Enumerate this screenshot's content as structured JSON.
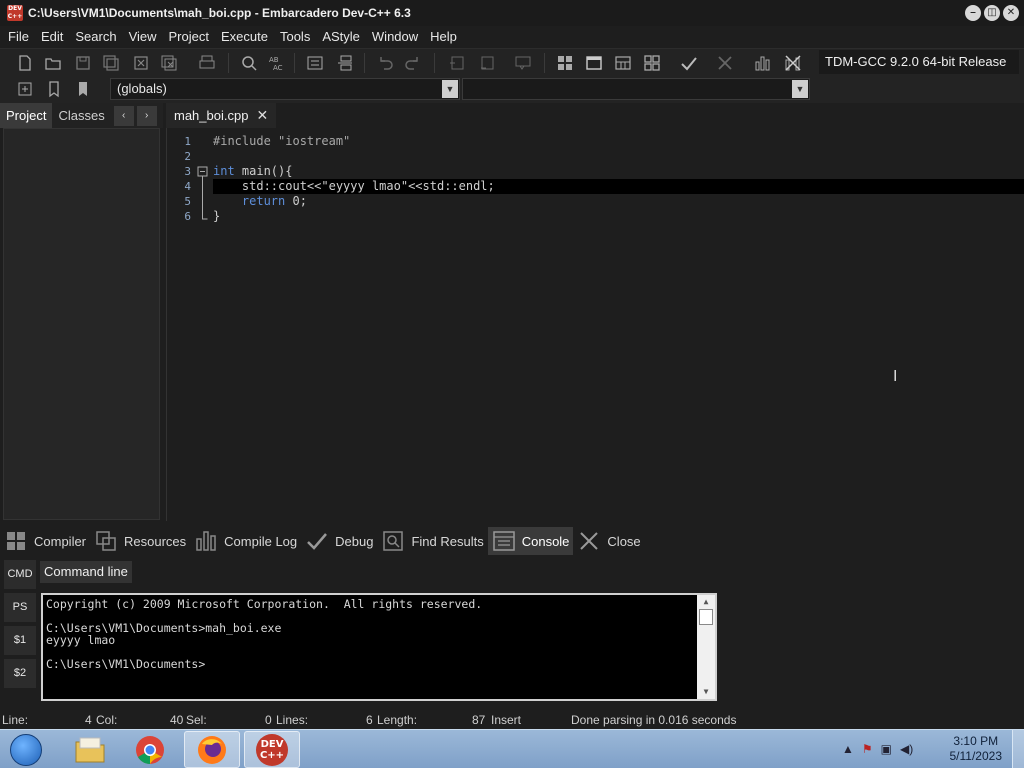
{
  "window": {
    "app_icon_text": "DEV C++",
    "title": "C:\\Users\\VM1\\Documents\\mah_boi.cpp - Embarcadero Dev-C++ 6.3",
    "minimize": "–",
    "maximize": "◫",
    "close": "✕"
  },
  "menu": [
    "File",
    "Edit",
    "Search",
    "View",
    "Project",
    "Execute",
    "Tools",
    "AStyle",
    "Window",
    "Help"
  ],
  "toolbar": {
    "compiler": "TDM-GCC 9.2.0 64-bit Release",
    "scope_combo": "(globals)",
    "second_combo": ""
  },
  "left_panel": {
    "tabs": [
      "Project",
      "Classes"
    ],
    "prev": "‹",
    "next": "›"
  },
  "editor": {
    "tab_label": "mah_boi.cpp",
    "tab_close": "✕",
    "line_numbers": [
      "1",
      "2",
      "3",
      "4",
      "5",
      "6"
    ],
    "lines": [
      {
        "type": "include",
        "directive": "#include",
        "arg": " \"iostream\""
      },
      {
        "type": "blank",
        "text": ""
      },
      {
        "type": "func",
        "kw": "int",
        "rest": " main(){"
      },
      {
        "type": "stmt",
        "text": "    std::cout<<\"eyyyy lmao\"<<std::endl;"
      },
      {
        "type": "ret",
        "kw": "return",
        "rest": " 0;"
      },
      {
        "type": "close",
        "text": "}"
      }
    ]
  },
  "bottom_tabs": [
    "Compiler",
    "Resources",
    "Compile Log",
    "Debug",
    "Find Results",
    "Console",
    "Close"
  ],
  "console": {
    "side_buttons": [
      "CMD",
      "PS",
      "$1",
      "$2"
    ],
    "tab": "Command line",
    "lines": [
      "Copyright (c) 2009 Microsoft Corporation.  All rights reserved.",
      "",
      "C:\\Users\\VM1\\Documents>mah_boi.exe",
      "eyyyy lmao",
      "",
      "C:\\Users\\VM1\\Documents>"
    ]
  },
  "status": {
    "line_label": "Line:",
    "line_value": "4",
    "col_label": "Col:",
    "col_value": "40",
    "sel_label": "Sel:",
    "sel_value": "0",
    "lines_label": "Lines:",
    "lines_value": "6",
    "length_label": "Length:",
    "length_value": "87",
    "mode": "Insert",
    "message": "Done parsing in 0.016 seconds"
  },
  "taskbar": {
    "dev_label": "DEV C++",
    "time": "3:10 PM",
    "date": "5/11/2023"
  }
}
